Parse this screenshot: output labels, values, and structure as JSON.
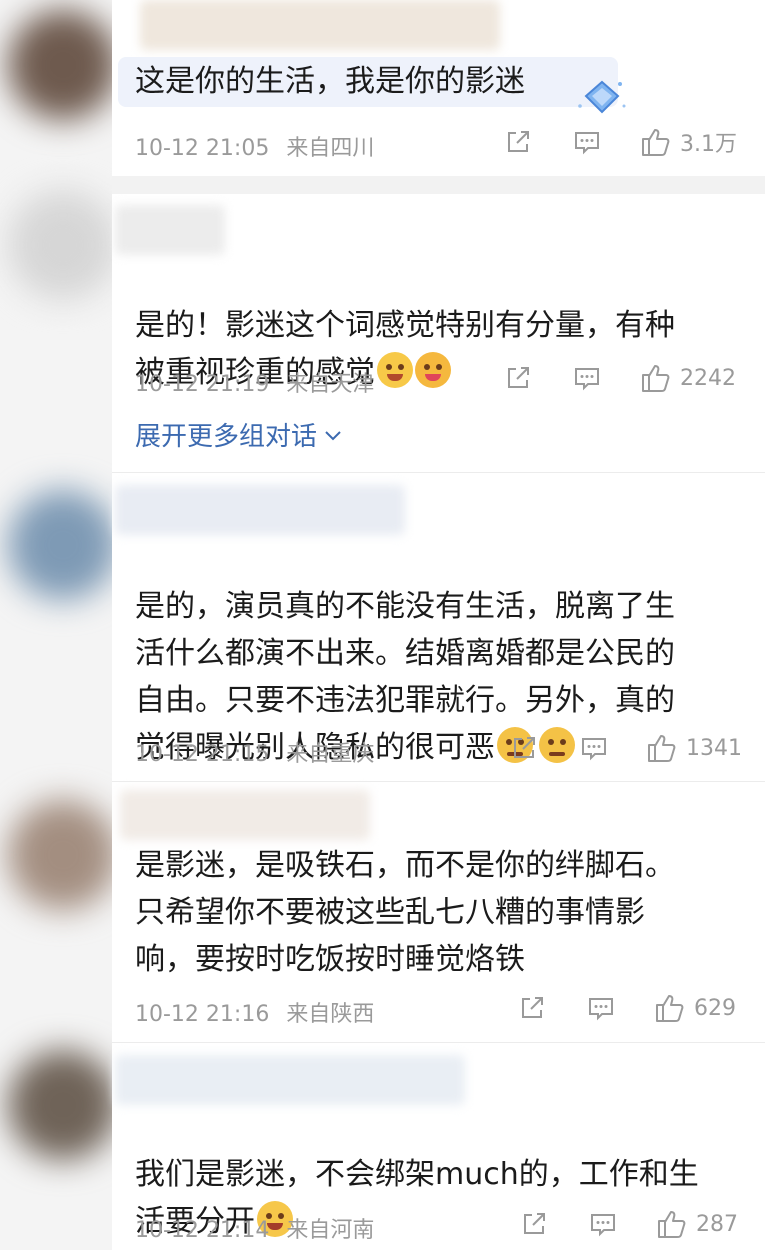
{
  "comments": [
    {
      "text": "这是你的生活，我是你的影迷",
      "date": "10-12 21:05",
      "location": "来自四川",
      "likes": "3.1万",
      "emoji": []
    },
    {
      "text": "是的！影迷这个词感觉特别有分量，有种\n被重视珍重的感觉",
      "date": "10-12 21:19",
      "location": "来自天津",
      "likes": "2242",
      "emoji": [
        "hug-emoji",
        "love-emoji"
      ],
      "expand_label": "展开更多组对话"
    },
    {
      "text": "是的，演员真的不能没有生活，脱离了生\n活什么都演不出来。结婚离婚都是公民的\n自由。只要不违法犯罪就行。另外，真的\n觉得曝光别人隐私的很可恶",
      "date": "10-12 21:15",
      "location": "来自重庆",
      "likes": "1341",
      "emoji": [
        "angry-emoji",
        "angry-emoji"
      ]
    },
    {
      "text": "是影迷，是吸铁石，而不是你的绊脚石。\n只希望你不要被这些乱七八糟的事情影\n响，要按时吃饭按时睡觉烙铁",
      "date": "10-12 21:16",
      "location": "来自陕西",
      "likes": "629",
      "emoji": []
    },
    {
      "text": "我们是影迷，不会绑架much的，工作和生\n活要分开",
      "date": "10-12 21:14",
      "location": "来自河南",
      "likes": "287",
      "emoji": [
        "crying-emoji"
      ]
    }
  ],
  "colors": {
    "accent_link": "#3c6ab0",
    "meta_gray": "#9a9a9a",
    "text": "#1b1b1b"
  }
}
